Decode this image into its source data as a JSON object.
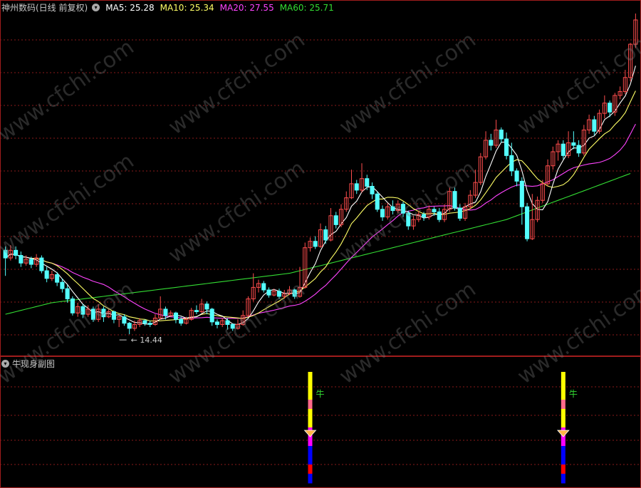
{
  "header": {
    "stock_label": "神州数码(日线 前复权)",
    "ma5": "MA5: 25.28",
    "ma10": "MA10: 25.34",
    "ma20": "MA20: 27.55",
    "ma60": "MA60: 25.71"
  },
  "colors": {
    "up": "#ff4d4d",
    "down": "#54ffff",
    "ma5": "#ffffff",
    "ma10": "#ffff66",
    "ma20": "#ff44ff",
    "ma60": "#33dd33",
    "grid": "#8a1a1a",
    "border": "#a01c1c"
  },
  "sub_panel": {
    "title": "牛现身副图",
    "signal_label": "牛"
  },
  "watermark": "www.cfchi.com",
  "chart_data": {
    "type": "candlestick",
    "ylim": [
      13,
      40
    ],
    "low_annotation": "14.44",
    "candles": [
      [
        21.0,
        20.4,
        21.3,
        19.0
      ],
      [
        20.4,
        21.0,
        21.4,
        20.2
      ],
      [
        21.0,
        20.6,
        21.3,
        20.3
      ],
      [
        20.6,
        20.0,
        20.9,
        19.7
      ],
      [
        20.0,
        20.3,
        20.6,
        19.8
      ],
      [
        20.3,
        19.9,
        20.5,
        19.6
      ],
      [
        19.9,
        20.4,
        20.7,
        19.7
      ],
      [
        20.4,
        19.4,
        20.6,
        19.2
      ],
      [
        19.4,
        18.8,
        19.7,
        18.5
      ],
      [
        18.8,
        19.1,
        19.4,
        18.6
      ],
      [
        19.1,
        18.5,
        19.3,
        18.2
      ],
      [
        18.5,
        18.0,
        18.8,
        17.7
      ],
      [
        18.0,
        17.2,
        18.3,
        16.9
      ],
      [
        17.2,
        16.1,
        17.4,
        15.9
      ],
      [
        16.1,
        16.6,
        16.9,
        15.8
      ],
      [
        16.6,
        16.0,
        16.8,
        15.7
      ],
      [
        16.0,
        16.4,
        16.7,
        15.8
      ],
      [
        16.4,
        15.6,
        16.6,
        15.4
      ],
      [
        15.6,
        16.4,
        16.8,
        15.4
      ],
      [
        16.4,
        15.8,
        16.6,
        15.4
      ],
      [
        15.8,
        16.2,
        16.4,
        15.7
      ],
      [
        16.2,
        15.6,
        16.3,
        15.3
      ],
      [
        15.6,
        15.8,
        15.9,
        15.0
      ],
      [
        15.8,
        15.3,
        16.0,
        15.1
      ],
      [
        15.3,
        14.9,
        15.4,
        14.44
      ],
      [
        14.9,
        15.2,
        15.5,
        14.7
      ],
      [
        15.2,
        15.5,
        15.7,
        15.0
      ],
      [
        15.5,
        15.3,
        15.6,
        15.1
      ],
      [
        15.3,
        15.2,
        15.5,
        15.0
      ],
      [
        15.2,
        15.7,
        16.0,
        15.1
      ],
      [
        15.7,
        16.4,
        17.4,
        15.6
      ],
      [
        16.4,
        15.9,
        16.6,
        15.6
      ],
      [
        15.9,
        16.1,
        16.3,
        15.8
      ],
      [
        16.1,
        15.6,
        16.2,
        15.3
      ],
      [
        15.6,
        15.3,
        15.8,
        15.1
      ],
      [
        15.3,
        15.6,
        15.8,
        15.2
      ],
      [
        15.6,
        16.3,
        16.5,
        15.5
      ],
      [
        16.3,
        16.2,
        16.7,
        16.0
      ],
      [
        16.2,
        16.8,
        17.2,
        16.1
      ],
      [
        16.8,
        16.4,
        17.0,
        16.0
      ],
      [
        16.4,
        15.4,
        16.5,
        15.1
      ],
      [
        15.4,
        15.2,
        15.6,
        14.9
      ],
      [
        15.2,
        15.5,
        15.7,
        15.0
      ],
      [
        15.5,
        15.2,
        15.7,
        14.8
      ],
      [
        15.2,
        14.9,
        15.3,
        14.7
      ],
      [
        14.9,
        15.2,
        15.6,
        14.8
      ],
      [
        15.2,
        15.9,
        16.3,
        15.1
      ],
      [
        15.9,
        17.2,
        17.4,
        15.8
      ],
      [
        17.2,
        18.1,
        19.2,
        17.0
      ],
      [
        18.1,
        18.4,
        18.7,
        17.7
      ],
      [
        18.4,
        17.9,
        18.6,
        17.7
      ],
      [
        17.9,
        17.5,
        18.1,
        17.3
      ],
      [
        17.5,
        17.8,
        18.0,
        17.4
      ],
      [
        17.8,
        17.4,
        18.0,
        17.2
      ],
      [
        17.4,
        17.6,
        17.9,
        17.2
      ],
      [
        17.6,
        17.9,
        18.2,
        17.5
      ],
      [
        17.9,
        17.4,
        18.0,
        17.2
      ],
      [
        17.4,
        18.1,
        19.7,
        17.3
      ],
      [
        18.1,
        21.2,
        21.6,
        18.0
      ],
      [
        21.2,
        21.7,
        22.0,
        20.9
      ],
      [
        21.7,
        21.3,
        22.1,
        21.1
      ],
      [
        21.3,
        22.6,
        23.1,
        21.2
      ],
      [
        22.6,
        21.8,
        22.9,
        21.5
      ],
      [
        21.8,
        23.7,
        24.3,
        21.7
      ],
      [
        23.7,
        23.0,
        24.0,
        22.7
      ],
      [
        23.0,
        24.2,
        24.6,
        22.8
      ],
      [
        24.2,
        25.1,
        25.6,
        24.0
      ],
      [
        25.1,
        26.2,
        27.3,
        25.0
      ],
      [
        26.2,
        25.7,
        26.5,
        25.4
      ],
      [
        25.7,
        26.6,
        27.8,
        25.5
      ],
      [
        26.6,
        26.0,
        26.9,
        25.7
      ],
      [
        26.0,
        25.4,
        26.3,
        25.0
      ],
      [
        25.4,
        24.2,
        25.6,
        24.0
      ],
      [
        24.2,
        23.6,
        24.5,
        23.3
      ],
      [
        23.6,
        24.4,
        24.7,
        23.4
      ],
      [
        24.4,
        24.1,
        24.9,
        23.8
      ],
      [
        24.1,
        24.6,
        24.9,
        23.9
      ],
      [
        24.6,
        23.9,
        24.8,
        23.6
      ],
      [
        23.9,
        22.9,
        24.1,
        22.6
      ],
      [
        22.9,
        23.4,
        23.7,
        22.6
      ],
      [
        23.4,
        23.8,
        24.1,
        23.2
      ],
      [
        23.8,
        23.6,
        24.0,
        23.3
      ],
      [
        23.6,
        24.2,
        24.5,
        23.4
      ],
      [
        24.2,
        24.0,
        24.4,
        23.7
      ],
      [
        24.0,
        23.4,
        24.3,
        23.2
      ],
      [
        23.4,
        24.2,
        24.6,
        23.2
      ],
      [
        24.2,
        25.6,
        25.9,
        24.0
      ],
      [
        25.6,
        24.3,
        25.9,
        24.1
      ],
      [
        24.3,
        23.5,
        24.6,
        23.3
      ],
      [
        23.5,
        24.4,
        24.7,
        23.3
      ],
      [
        24.4,
        25.3,
        25.7,
        24.2
      ],
      [
        25.3,
        26.3,
        27.3,
        25.1
      ],
      [
        26.3,
        28.3,
        28.6,
        26.1
      ],
      [
        28.3,
        29.6,
        30.3,
        28.1
      ],
      [
        29.6,
        29.2,
        30.1,
        28.8
      ],
      [
        29.2,
        30.4,
        31.2,
        29.0
      ],
      [
        30.4,
        29.7,
        30.6,
        29.4
      ],
      [
        29.7,
        28.4,
        30.2,
        28.1
      ],
      [
        28.4,
        27.2,
        29.4,
        26.8
      ],
      [
        27.2,
        26.4,
        27.4,
        26.0
      ],
      [
        26.4,
        24.4,
        26.7,
        23.0
      ],
      [
        24.4,
        21.9,
        24.7,
        21.7
      ],
      [
        21.9,
        23.4,
        25.4,
        21.8
      ],
      [
        23.4,
        24.9,
        25.2,
        23.2
      ],
      [
        24.9,
        26.2,
        26.5,
        24.7
      ],
      [
        26.2,
        27.6,
        28.1,
        26.0
      ],
      [
        27.6,
        28.7,
        29.1,
        27.3
      ],
      [
        28.7,
        29.3,
        29.6,
        28.0
      ],
      [
        29.3,
        28.4,
        29.6,
        28.1
      ],
      [
        28.4,
        29.4,
        30.3,
        28.2
      ],
      [
        29.4,
        29.2,
        30.3,
        28.9
      ],
      [
        29.2,
        28.6,
        29.6,
        28.3
      ],
      [
        28.6,
        30.4,
        30.8,
        28.4
      ],
      [
        30.4,
        31.2,
        31.6,
        30.1
      ],
      [
        31.2,
        30.3,
        31.5,
        30.0
      ],
      [
        30.3,
        31.7,
        32.0,
        30.1
      ],
      [
        31.7,
        32.5,
        33.1,
        31.3
      ],
      [
        32.5,
        31.8,
        32.7,
        31.4
      ],
      [
        31.8,
        33.1,
        33.3,
        31.5
      ],
      [
        33.1,
        33.4,
        33.8,
        32.8
      ],
      [
        33.4,
        34.5,
        35.1,
        33.2
      ],
      [
        34.5,
        37.1,
        37.2,
        34.2
      ],
      [
        37.1,
        39.0,
        39.5,
        36.8
      ]
    ],
    "ma60": [
      16.0,
      16.1,
      16.2,
      16.3,
      16.4,
      16.5,
      16.6,
      16.7,
      16.8,
      16.9,
      16.95,
      17.0,
      17.05,
      17.1,
      17.15,
      17.2,
      17.25,
      17.3,
      17.35,
      17.4,
      17.45,
      17.5,
      17.55,
      17.6,
      17.65,
      17.7,
      17.75,
      17.8,
      17.85,
      17.9,
      17.95,
      18.0,
      18.05,
      18.1,
      18.15,
      18.2,
      18.25,
      18.3,
      18.35,
      18.4,
      18.45,
      18.5,
      18.55,
      18.6,
      18.65,
      18.7,
      18.75,
      18.8,
      18.85,
      18.9,
      18.95,
      19.0,
      19.05,
      19.1,
      19.15,
      19.2,
      19.3,
      19.4,
      19.5,
      19.6,
      19.7,
      19.8,
      19.9,
      20.0,
      20.1,
      20.2,
      20.3,
      20.4,
      20.5,
      20.6,
      20.7,
      20.8,
      20.9,
      21.0,
      21.1,
      21.2,
      21.3,
      21.4,
      21.5,
      21.6,
      21.7,
      21.8,
      21.9,
      22.0,
      22.1,
      22.2,
      22.3,
      22.4,
      22.5,
      22.6,
      22.7,
      22.8,
      22.9,
      23.0,
      23.1,
      23.2,
      23.3,
      23.4,
      23.55,
      23.7,
      23.85,
      24.0,
      24.15,
      24.3,
      24.45,
      24.6,
      24.75,
      24.9,
      25.05,
      25.2,
      25.35,
      25.5,
      25.65,
      25.8,
      25.95,
      26.1,
      26.25,
      26.4,
      26.55,
      26.7,
      26.85,
      27.0
    ],
    "signals": [
      {
        "index": 59,
        "segments": [
          "yellow",
          "yellow",
          "yellow",
          "pink",
          "yellow",
          "yellow",
          "magenta",
          "magenta",
          "blue",
          "blue",
          "red",
          "blue"
        ]
      },
      {
        "index": 108,
        "segments": [
          "yellow",
          "yellow",
          "yellow",
          "pink",
          "yellow",
          "yellow",
          "magenta",
          "magenta",
          "blue",
          "blue",
          "red",
          "blue"
        ]
      }
    ]
  }
}
